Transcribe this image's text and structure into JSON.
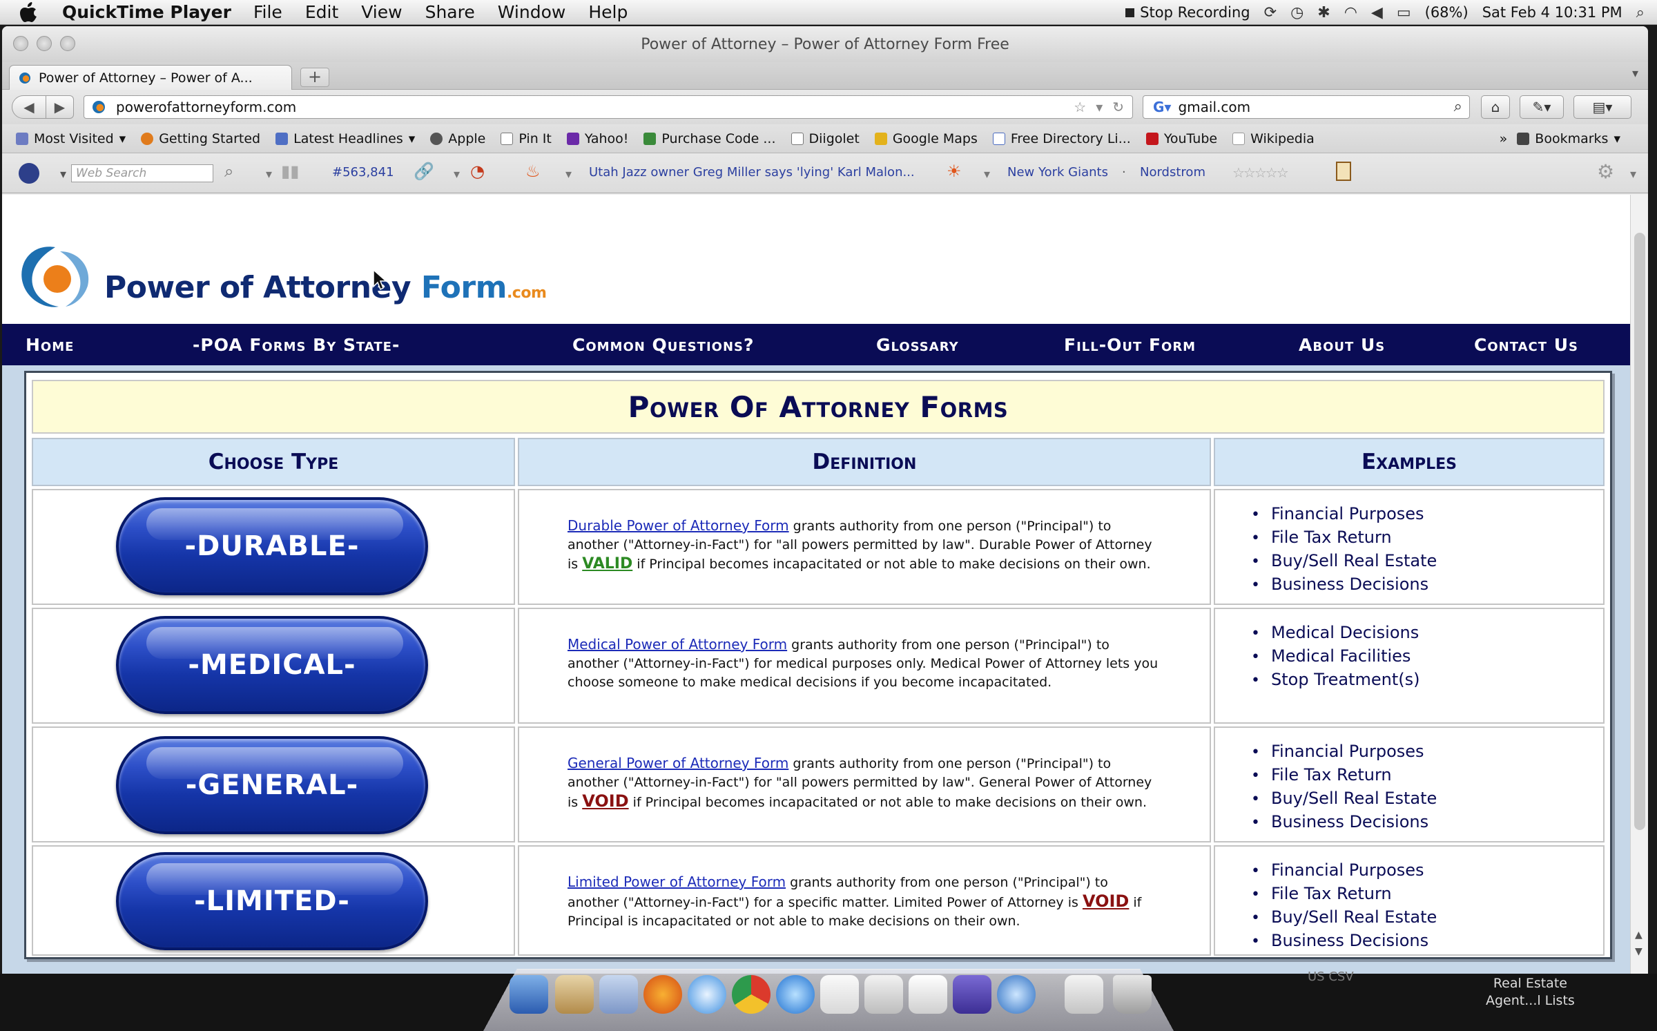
{
  "menubar": {
    "app_name": "QuickTime Player",
    "menus": [
      "File",
      "Edit",
      "View",
      "Share",
      "Window",
      "Help"
    ],
    "stop_recording": "Stop Recording",
    "battery": "(68%)",
    "datetime": "Sat Feb 4  10:31 PM"
  },
  "window": {
    "title": "Power of Attorney – Power of Attorney Form Free",
    "tab_label": "Power of Attorney – Power of A...",
    "url": "powerofattorneyform.com",
    "search_value": "gmail.com"
  },
  "bookmarks": {
    "items": [
      "Most Visited",
      "Getting Started",
      "Latest Headlines",
      "Apple",
      "Pin It",
      "Yahoo!",
      "Purchase Code ...",
      "Diigolet",
      "Google Maps",
      "Free Directory Li...",
      "YouTube",
      "Wikipedia"
    ],
    "bookmarks_menu": "Bookmarks"
  },
  "toolbar2": {
    "web_search_placeholder": "Web Search",
    "count": "#563,841",
    "headline": "Utah Jazz owner Greg Miller says 'lying' Karl Malon...",
    "link_giants": "New York Giants",
    "link_nordstrom": "Nordstrom"
  },
  "site": {
    "logo_main": "Power of Attorney ",
    "logo_form": "Form",
    "logo_com": ".com",
    "nav": [
      "Home",
      "-POA Forms By State-",
      "Common Questions?",
      "Glossary",
      "Fill-Out Form",
      "About Us",
      "Contact Us"
    ],
    "banner": "Power Of Attorney Forms",
    "headers": {
      "type": "Choose Type",
      "definition": "Definition",
      "examples": "Examples"
    },
    "rows": [
      {
        "button": "-DURABLE-",
        "link": "Durable Power of Attorney Form",
        "text1": " grants authority from one person (\"Principal\") to another (\"Attorney-in-Fact\") for \"all powers permitted by law\". Durable Power of Attorney is ",
        "flag": "VALID",
        "text2": " if Principal becomes incapacitated or not able to make decisions on their own.",
        "examples": [
          "Financial Purposes",
          "File Tax Return",
          "Buy/Sell Real Estate",
          "Business Decisions"
        ]
      },
      {
        "button": "-MEDICAL-",
        "link": "Medical Power of Attorney Form",
        "text1": " grants authority from one person (\"Principal\") to another (\"Attorney-in-Fact\") for medical purposes only. Medical Power of Attorney lets you choose someone to make medical decisions if you become incapacitated.",
        "flag": "",
        "text2": "",
        "examples": [
          "Medical Decisions",
          "Medical Facilities",
          "Stop Treatment(s)"
        ]
      },
      {
        "button": "-GENERAL-",
        "link": "General Power of Attorney Form",
        "text1": " grants authority from one person (\"Principal\") to another (\"Attorney-in-Fact\") for \"all powers permitted by law\". General Power of Attorney is ",
        "flag": "VOID",
        "text2": " if Principal becomes incapacitated or not able to make decisions on their own.",
        "examples": [
          "Financial Purposes",
          "File Tax Return",
          "Buy/Sell Real Estate",
          "Business Decisions"
        ]
      },
      {
        "button": "-LIMITED-",
        "link": "Limited Power of Attorney Form",
        "text1": " grants authority from one person (\"Principal\") to another (\"Attorney-in-Fact\") for a specific matter. Limited Power of Attorney is ",
        "flag": "VOID",
        "text2": " if Principal is incapacitated or not able to make decisions on their own.",
        "examples": [
          "Financial Purposes",
          "File Tax Return",
          "Buy/Sell Real Estate",
          "Business Decisions"
        ]
      }
    ]
  },
  "dock": {
    "label": "Real Estate\nAgent...l Lists",
    "csv": "US CSV"
  },
  "colors": {
    "nav_bg": "#0a0c55",
    "banner_bg": "#fefcd6",
    "header_bg": "#d3e6f6",
    "pill": "#1535a8",
    "valid": "#2c8a23",
    "void": "#8a1111"
  }
}
